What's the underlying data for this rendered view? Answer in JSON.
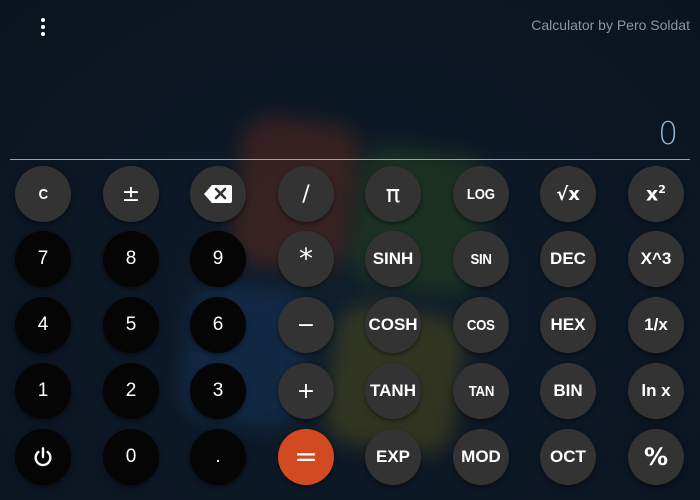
{
  "header": {
    "menu_icon": "more-vert-icon",
    "title": "Calculator by Pero Soldat"
  },
  "display": {
    "value": "0"
  },
  "keys": {
    "clear": "C",
    "plus_minus": "±",
    "backspace_icon": "backspace-icon",
    "divide": "/",
    "pi": "π",
    "log": "LOG",
    "sqrt": "√x",
    "square_base": "x",
    "square_exp": "2",
    "seven": "7",
    "eight": "8",
    "nine": "9",
    "multiply": "*",
    "sinh": "SINH",
    "sin": "SIN",
    "dec": "DEC",
    "cube": "X^3",
    "four": "4",
    "five": "5",
    "six": "6",
    "minus": "−",
    "cosh": "COSH",
    "cos": "COS",
    "hex": "HEX",
    "reciprocal": "1/x",
    "one": "1",
    "two": "2",
    "three": "3",
    "plus": "+",
    "tanh": "TANH",
    "tan": "TAN",
    "bin": "BIN",
    "ln": "ln x",
    "power_icon": "power-icon",
    "zero": "0",
    "decimal": ".",
    "equals": "=",
    "exp": "EXP",
    "mod": "MOD",
    "oct": "OCT",
    "percent": "%"
  },
  "colors": {
    "equals_key": "#d24a22",
    "function_key": "#333333",
    "digit_key": "#050505",
    "display_text": "#8fb4d6"
  }
}
